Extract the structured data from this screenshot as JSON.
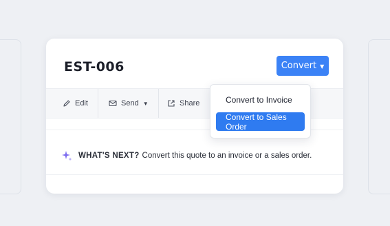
{
  "estimate": {
    "number": "EST-006"
  },
  "actions": {
    "convert_label": "Convert",
    "toolbar": {
      "edit": "Edit",
      "send": "Send",
      "share": "Share"
    }
  },
  "dropdown": {
    "items": [
      {
        "label": "Convert to Invoice",
        "selected": false
      },
      {
        "label": "Convert to Sales Order",
        "selected": true
      }
    ]
  },
  "next_steps": {
    "heading": "WHAT'S NEXT?",
    "text": "Convert this quote to an invoice or a sales order."
  },
  "colors": {
    "accent": "#3b82f6",
    "selected_item": "#2f7bf0",
    "sparkle": "#7c6cf0"
  },
  "icons": [
    "pencil-icon",
    "mail-icon",
    "chevron-down-icon",
    "share-icon",
    "sparkle-icon"
  ]
}
